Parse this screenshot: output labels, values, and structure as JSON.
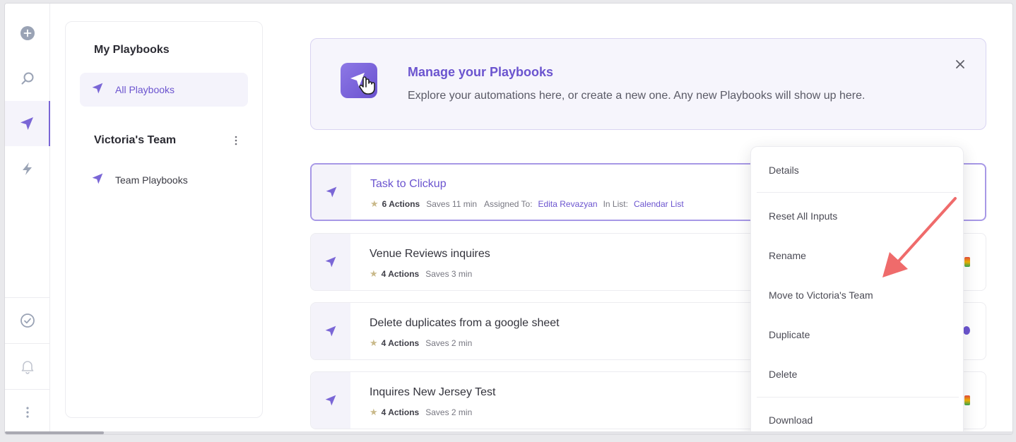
{
  "rail": {
    "items": [
      "add-icon",
      "search-icon",
      "playbooks-icon",
      "lightning-icon",
      "check-circle-icon",
      "bell-icon",
      "more-vertical-icon"
    ],
    "accent": "#7a66d6"
  },
  "sidebar": {
    "my_title": "My Playbooks",
    "all_label": "All Playbooks",
    "team_title": "Victoria's Team",
    "team_label": "Team Playbooks"
  },
  "banner": {
    "title": "Manage your Playbooks",
    "subtitle": "Explore your automations here, or create a new one. Any new Playbooks will show up here."
  },
  "rows": [
    {
      "title": "Task to Clickup",
      "actions": "6 Actions",
      "saves": "Saves 11 min",
      "assigned_label": "Assigned To:",
      "assigned_value": "Edita Revazyan",
      "list_label": "In List:",
      "list_value": "Calendar List"
    },
    {
      "title": "Venue Reviews inquires",
      "actions": "4 Actions",
      "saves": "Saves 3 min"
    },
    {
      "title": "Delete duplicates from a google sheet",
      "actions": "4 Actions",
      "saves": "Saves 2 min"
    },
    {
      "title": "Inquires New Jersey Test",
      "actions": "4 Actions",
      "saves": "Saves 2 min"
    }
  ],
  "menu": {
    "details": "Details",
    "reset": "Reset All Inputs",
    "rename": "Rename",
    "move": "Move to Victoria's Team",
    "duplicate": "Duplicate",
    "delete": "Delete",
    "download": "Download"
  },
  "colors": {
    "brand": "#6b54cf",
    "annotation_arrow": "#ef6b6b"
  }
}
